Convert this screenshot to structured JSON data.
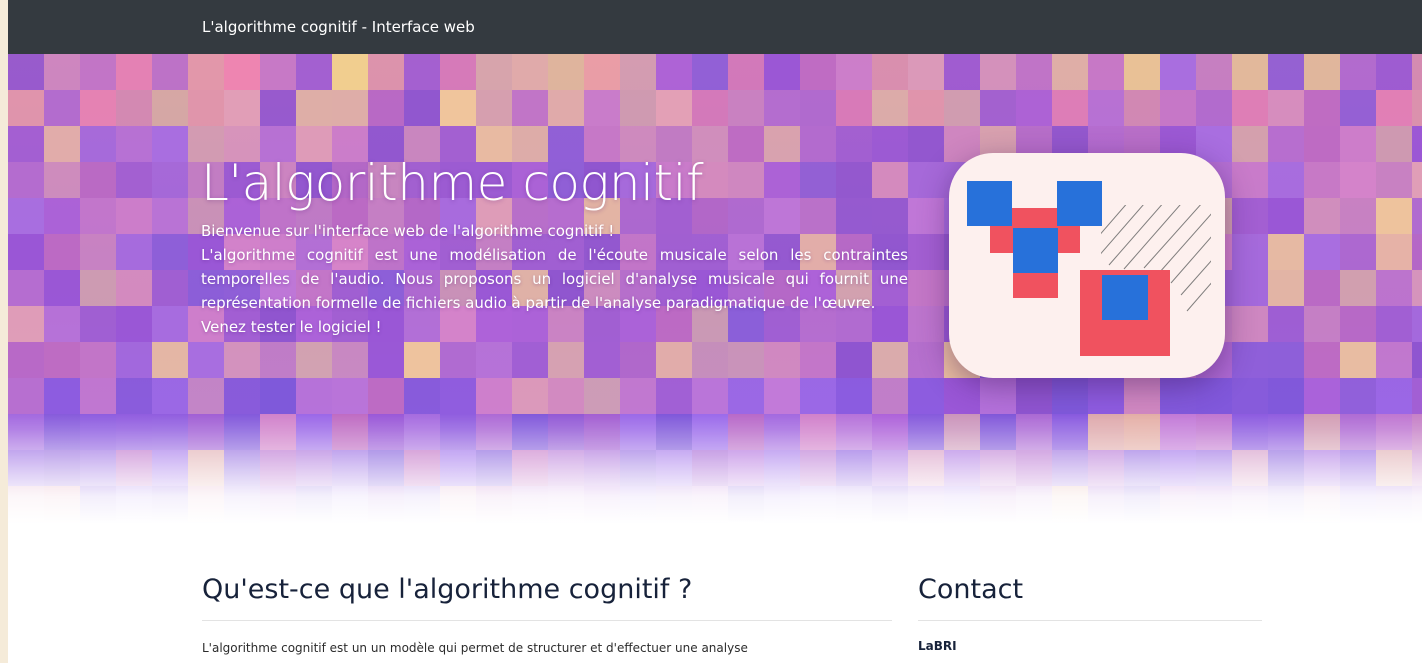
{
  "navbar": {
    "brand": "L'algorithme cognitif - Interface web"
  },
  "hero": {
    "title": "L'algorithme cognitif",
    "lead": [
      "Bienvenue sur l'interface web de l'algorithme cognitif !",
      "L'algorithme cognitif est une modélisation de l'écoute musicale selon les contraintes temporelles de l'audio. Nous proposons un logiciel d'analyse musicale qui fournit une représentation formelle de fichiers audio à partir de l'analyse paradigmatique de l'œuvre.",
      "Venez tester le logiciel !"
    ]
  },
  "about": {
    "title": "Qu'est-ce que l'algorithme cognitif ?",
    "text": "L'algorithme cognitif est un un modèle qui permet de structurer et d'effectuer une analyse"
  },
  "contact": {
    "title": "Contact",
    "name": "LaBRI"
  },
  "colors": {
    "navbar": "#343a40",
    "logo_blue": "#2771da",
    "logo_red": "#f0525f",
    "logo_bg": "#fdf0ee",
    "heading": "#17223a"
  }
}
